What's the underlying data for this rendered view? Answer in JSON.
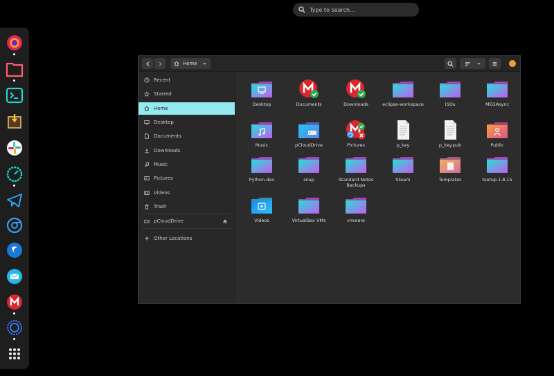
{
  "search": {
    "placeholder": "Type to search..."
  },
  "colors": {
    "accent": "#93eaf0",
    "folder_top": "#25e0d8",
    "folder_bottom": "#c35cf0",
    "window_bg": "#2c2c2c"
  },
  "dock": {
    "apps": [
      "firefox",
      "files",
      "terminal",
      "system-installer",
      "slack",
      "speedometer",
      "telegram",
      "chromium",
      "simplenote",
      "mail",
      "mega",
      "signal",
      "app-grid"
    ]
  },
  "headerbar": {
    "path_label": "Home"
  },
  "sidebar": {
    "items": [
      {
        "label": "Recent",
        "icon": "clock-icon"
      },
      {
        "label": "Starred",
        "icon": "star-icon"
      },
      {
        "label": "Home",
        "icon": "home-icon"
      },
      {
        "label": "Desktop",
        "icon": "desktop-icon"
      },
      {
        "label": "Documents",
        "icon": "document-icon"
      },
      {
        "label": "Downloads",
        "icon": "download-icon"
      },
      {
        "label": "Music",
        "icon": "music-icon"
      },
      {
        "label": "Pictures",
        "icon": "picture-icon"
      },
      {
        "label": "Videos",
        "icon": "video-icon"
      },
      {
        "label": "Trash",
        "icon": "trash-icon"
      },
      {
        "label": "pCloudDrive",
        "icon": "drive-icon"
      },
      {
        "label": "Other Locations",
        "icon": "plus-icon"
      }
    ]
  },
  "files": [
    {
      "label": "Desktop",
      "kind": "folder-desktop"
    },
    {
      "label": "Documents",
      "kind": "mega-ok"
    },
    {
      "label": "Downloads",
      "kind": "mega-ok"
    },
    {
      "label": "eclipse-workspace",
      "kind": "folder"
    },
    {
      "label": "ISOs",
      "kind": "folder"
    },
    {
      "label": "MEGAsync",
      "kind": "folder"
    },
    {
      "label": "Music",
      "kind": "folder-music"
    },
    {
      "label": "pCloudDrive",
      "kind": "folder-drive"
    },
    {
      "label": "Pictures",
      "kind": "mega-sync"
    },
    {
      "label": "p_key",
      "kind": "doc"
    },
    {
      "label": "p_key.pub",
      "kind": "doc"
    },
    {
      "label": "Public",
      "kind": "folder-public"
    },
    {
      "label": "Python-dev",
      "kind": "folder"
    },
    {
      "label": "snap",
      "kind": "folder"
    },
    {
      "label": "Standard Notes Backups",
      "kind": "folder"
    },
    {
      "label": "Steam",
      "kind": "folder"
    },
    {
      "label": "Templates",
      "kind": "folder-templates"
    },
    {
      "label": "tsetup.1.8.15",
      "kind": "folder"
    },
    {
      "label": "Videos",
      "kind": "folder-videos"
    },
    {
      "label": "VirtualBox VMs",
      "kind": "folder"
    },
    {
      "label": "vmware",
      "kind": "folder"
    }
  ]
}
